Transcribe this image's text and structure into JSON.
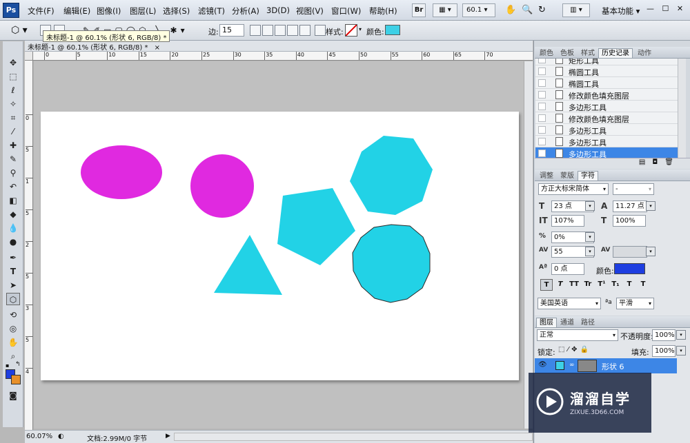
{
  "app": {
    "logo": "Ps"
  },
  "menu": [
    "文件(F)",
    "编辑(E)",
    "图像(I)",
    "图层(L)",
    "选择(S)",
    "滤镜(T)",
    "分析(A)",
    "3D(D)",
    "视图(V)",
    "窗口(W)",
    "帮助(H)"
  ],
  "menubar": {
    "bridge": "Br",
    "zoom": "60.1",
    "workspace": "基本功能"
  },
  "options": {
    "sides_label": "边:",
    "sides_value": "15",
    "style_label": "样式:",
    "color_label": "颜色:",
    "shape_color": "#3dd0e6"
  },
  "document": {
    "tab_title": "未标题-1 @ 60.1% (形状 6, RGB/8) *",
    "tooltip": "未标题-1 @ 60.1% (形状 6, RGB/8) *"
  },
  "ruler": {
    "h_ticks": [
      "0",
      "5",
      "10",
      "15",
      "20",
      "25",
      "30",
      "35",
      "40",
      "45",
      "50",
      "55",
      "60",
      "65",
      "70"
    ],
    "v_ticks": [
      "0",
      "5",
      "1",
      "5",
      "2",
      "5",
      "3",
      "5",
      "4"
    ]
  },
  "status": {
    "zoom": "60.07%",
    "doc_info": "文档:2.99M/0 字节"
  },
  "history_panel": {
    "tabs": [
      "颜色",
      "色板",
      "样式",
      "历史记录",
      "动作"
    ],
    "active_tab": "历史记录",
    "items": [
      "矩形工具",
      "椭圆工具",
      "椭圆工具",
      "修改颜色填充图层",
      "多边形工具",
      "修改颜色填充图层",
      "多边形工具",
      "多边形工具",
      "多边形工具"
    ]
  },
  "character_panel": {
    "tabs": [
      "调整",
      "蒙版",
      "字符"
    ],
    "active_tab": "字符",
    "font_family": "方正大标宋简体",
    "font_style": "-",
    "font_size": "23 点",
    "leading": "11.27 点",
    "vertical_scale": "107%",
    "horizontal_scale": "100%",
    "tsume": "0%",
    "tracking": "55",
    "baseline_shift": "0 点",
    "color_label": "颜色:",
    "text_color": "#1e3ee0",
    "style_buttons": [
      "T",
      "T",
      "TT",
      "Tr",
      "T¹",
      "T₁",
      "T",
      "T"
    ],
    "language": "美国英语",
    "aa_label": "ªa",
    "antialias": "平滑"
  },
  "layers_panel": {
    "tabs": [
      "图层",
      "通道",
      "路径"
    ],
    "active_tab": "图层",
    "blend_mode": "正常",
    "opacity_label": "不透明度:",
    "opacity": "100%",
    "lock_label": "锁定:",
    "fill_label": "填充:",
    "fill": "100%",
    "layer_name": "形状 6"
  },
  "watermark": {
    "title": "溜溜自学",
    "url": "ZIXUE.3D66.COM"
  }
}
